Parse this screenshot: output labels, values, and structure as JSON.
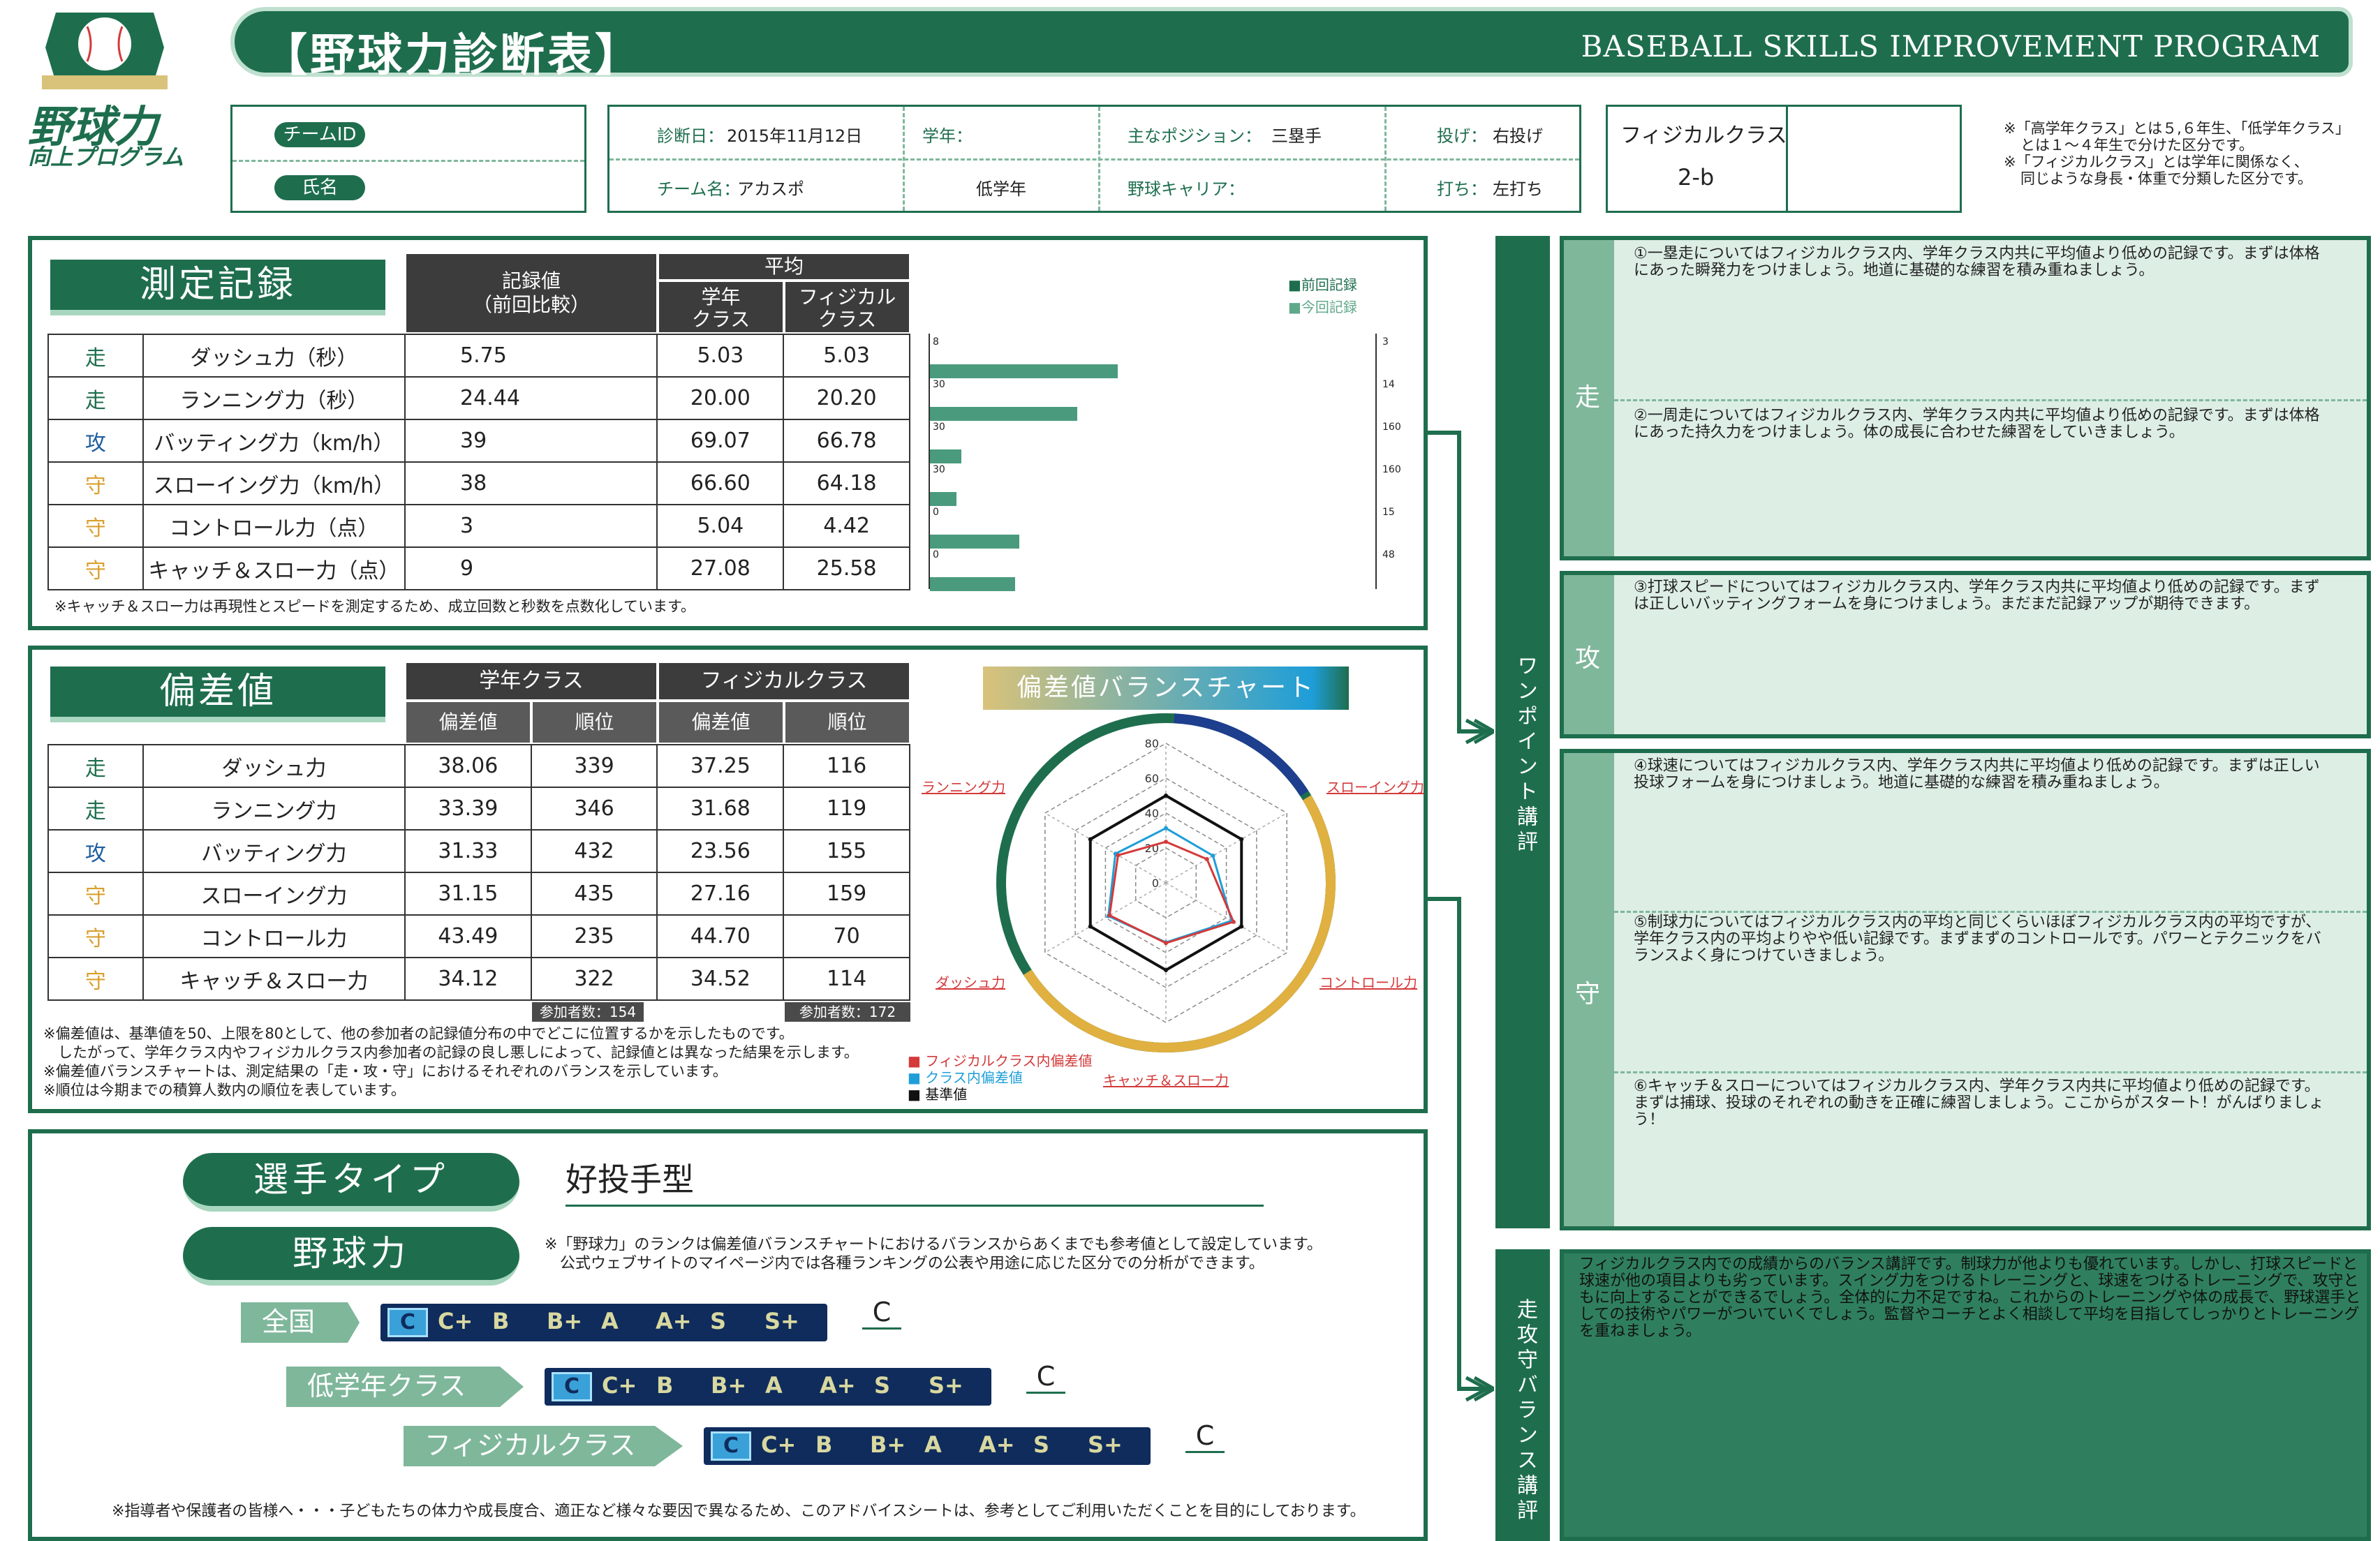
{
  "header": {
    "title": "【野球力診断表】",
    "subtitle": "BASEBALL SKILLS IMPROVEMENT PROGRAM",
    "logo_text": "野球力 向上プログラム"
  },
  "player": {
    "team_id_label": "チームID",
    "name_label": "氏名"
  },
  "info": {
    "date_label": "診断日：",
    "date_value": "2015年11月12日",
    "grade_label": "学年：",
    "grade_value": "低学年",
    "position_label": "主なポジション：",
    "position_value": "三塁手",
    "throw_label": "投げ：",
    "throw_value": "右投げ",
    "team_label": "チーム名：",
    "team_value": "アカスポ",
    "career_label": "野球キャリア：",
    "bat_label": "打ち：",
    "bat_value": "左打ち"
  },
  "physical": {
    "label": "フィジカルクラス",
    "value": "2-b"
  },
  "top_notes": [
    "※「高学年クラス」とは５,６年生、「低学年クラス」",
    "とは１〜４年生で分けた区分です。",
    "※「フィジカルクラス」とは学年に関係なく、",
    "同じような身長・体重で分類した区分です。"
  ],
  "measure": {
    "heading": "測定記録",
    "col_record": "記録値\n（前回比較）",
    "col_avg": "平均",
    "col_grade": "学年\nクラス",
    "col_phys": "フィジカル\nクラス",
    "legend_prev": "■前回記録",
    "legend_cur": "■今回記録",
    "rows": [
      {
        "cat": "走",
        "name": "ダッシュ力（秒）",
        "value": "5.75",
        "grade": "5.03",
        "phys": "5.03",
        "min": "8",
        "max": "3",
        "bar": 0.42
      },
      {
        "cat": "走",
        "name": "ランニング力（秒）",
        "value": "24.44",
        "grade": "20.00",
        "phys": "20.20",
        "min": "30",
        "max": "14",
        "bar": 0.33
      },
      {
        "cat": "攻",
        "name": "バッティング力（km/h）",
        "value": "39",
        "grade": "69.07",
        "phys": "66.78",
        "min": "30",
        "max": "160",
        "bar": 0.07
      },
      {
        "cat": "守",
        "name": "スローイング力（km/h）",
        "value": "38",
        "grade": "66.60",
        "phys": "64.18",
        "min": "30",
        "max": "160",
        "bar": 0.06
      },
      {
        "cat": "守",
        "name": "コントロール力（点）",
        "value": "3",
        "grade": "5.04",
        "phys": "4.42",
        "min": "0",
        "max": "15",
        "bar": 0.2
      },
      {
        "cat": "守",
        "name": "キャッチ＆スロー力（点）",
        "value": "9",
        "grade": "27.08",
        "phys": "25.58",
        "min": "0",
        "max": "48",
        "bar": 0.19
      }
    ],
    "note": "※キャッチ＆スロー力は再現性とスピードを測定するため、成立回数と秒数を点数化しています。"
  },
  "deviation": {
    "heading": "偏差値",
    "col_grade": "学年クラス",
    "col_phys": "フィジカルクラス",
    "col_dev": "偏差値",
    "col_rank": "順位",
    "rows": [
      {
        "cat": "走",
        "name": "ダッシュ力",
        "g_dev": "38.06",
        "g_rank": "339",
        "p_dev": "37.25",
        "p_rank": "116"
      },
      {
        "cat": "走",
        "name": "ランニング力",
        "g_dev": "33.39",
        "g_rank": "346",
        "p_dev": "31.68",
        "p_rank": "119"
      },
      {
        "cat": "攻",
        "name": "バッティング力",
        "g_dev": "31.33",
        "g_rank": "432",
        "p_dev": "23.56",
        "p_rank": "155"
      },
      {
        "cat": "守",
        "name": "スローイング力",
        "g_dev": "31.15",
        "g_rank": "435",
        "p_dev": "27.16",
        "p_rank": "159"
      },
      {
        "cat": "守",
        "name": "コントロール力",
        "g_dev": "43.49",
        "g_rank": "235",
        "p_dev": "44.70",
        "p_rank": "70"
      },
      {
        "cat": "守",
        "name": "キャッチ＆スロー力",
        "g_dev": "34.12",
        "g_rank": "322",
        "p_dev": "34.52",
        "p_rank": "114"
      }
    ],
    "participants_grade": "参加者数：154",
    "participants_phys": "参加者数：172",
    "notes": [
      "※偏差値は、基準値を50、上限を80として、他の参加者の記録値分布の中でどこに位置するかを示したものです。",
      "　したがって、学年クラス内やフィジカルクラス内参加者の記録の良し悪しによって、記録値とは異なった結果を示します。",
      "※偏差値バランスチャートは、測定結果の「走・攻・守」におけるそれぞれのバランスを示しています。",
      "※順位は今期までの積算人数内の順位を表しています。"
    ]
  },
  "chart_data": {
    "type": "radar",
    "title": "偏差値バランスチャート",
    "axes": [
      "バッティング力",
      "スローイング力",
      "コントロール力",
      "キャッチ＆スロー力",
      "ダッシュ力",
      "ランニング力"
    ],
    "ticks": [
      "80",
      "60",
      "40",
      "20",
      "0"
    ],
    "range": [
      0,
      80
    ],
    "series": [
      {
        "name": "フィジカルクラス内偏差値",
        "color": "#d43a3a",
        "values": [
          23.56,
          27.16,
          44.7,
          34.52,
          37.25,
          31.68
        ]
      },
      {
        "name": "クラス内偏差値",
        "color": "#1e9ed8",
        "values": [
          31.33,
          31.15,
          43.49,
          34.12,
          38.06,
          33.39
        ]
      },
      {
        "name": "基準値",
        "color": "#111111",
        "values": [
          50,
          50,
          50,
          50,
          50,
          50
        ]
      }
    ]
  },
  "player_type": {
    "label": "選手タイプ",
    "value": "好投手型",
    "power_label": "野球力",
    "note1": "※「野球力」のランクは偏差値バランスチャートにおけるバランスからあくまでも参考値として設定しています。",
    "note2": "　公式ウェブサイトのマイページ内では各種ランキングの公表や用途に応じた区分での分析ができます。",
    "ranks": [
      "C",
      "C+",
      "B",
      "B+",
      "A",
      "A+",
      "S",
      "S+"
    ],
    "rows": [
      {
        "label": "全国",
        "result": "C"
      },
      {
        "label": "低学年クラス",
        "result": "C"
      },
      {
        "label": "フィジカルクラス",
        "result": "C"
      }
    ],
    "footer": "※指導者や保護者の皆様へ・・・子どもたちの体力や成長度合、適正など様々な要因で異なるため、このアドバイスシートは、参考としてご利用いただくことを目的にしております。"
  },
  "comments": {
    "side_label": "ワンポイント講評",
    "run_label": "走",
    "atk_label": "攻",
    "def_label": "守",
    "run1": "①一塁走についてはフィジカルクラス内、学年クラス内共に平均値より低めの記録です。まずは体格にあった瞬発力をつけましょう。地道に基礎的な練習を積み重ねましょう。",
    "run2": "②一周走についてはフィジカルクラス内、学年クラス内共に平均値より低めの記録です。まずは体格にあった持久力をつけましょう。体の成長に合わせた練習をしていきましょう。",
    "atk1": "③打球スピードについてはフィジカルクラス内、学年クラス内共に平均値より低めの記録です。まずは正しいバッティングフォームを身につけましょう。まだまだ記録アップが期待できます。",
    "def1": "④球速についてはフィジカルクラス内、学年クラス内共に平均値より低めの記録です。まずは正しい投球フォームを身につけましょう。地道に基礎的な練習を積み重ねましょう。",
    "def2": "⑤制球力についてはフィジカルクラス内の平均と同じくらいほぼフィジカルクラス内の平均ですが、学年クラス内の平均よりやや低い記録です。まずまずのコントロールです。パワーとテクニックをバランスよく身につけていきましょう。",
    "def3": "⑥キャッチ＆スローについてはフィジカルクラス内、学年クラス内共に平均値より低めの記録です。まずは捕球、投球のそれぞれの動きを正確に練習しましょう。ここからがスタート！がんばりましょう！",
    "balance_side": "走攻守バランス講評",
    "balance": "フィジカルクラス内での成績からのバランス講評です。制球力が他よりも優れています。しかし、打球スピードと球速が他の項目よりも劣っています。スイング力をつけるトレーニングと、球速をつけるトレーニングで、攻守ともに向上することができるでしょう。全体的に力不足ですね。これからのトレーニングや体の成長で、野球選手としての技術やパワーがついていくでしょう。監督やコーチとよく相談して平均を目指してしっかりとトレーニングを重ねましょう。"
  }
}
